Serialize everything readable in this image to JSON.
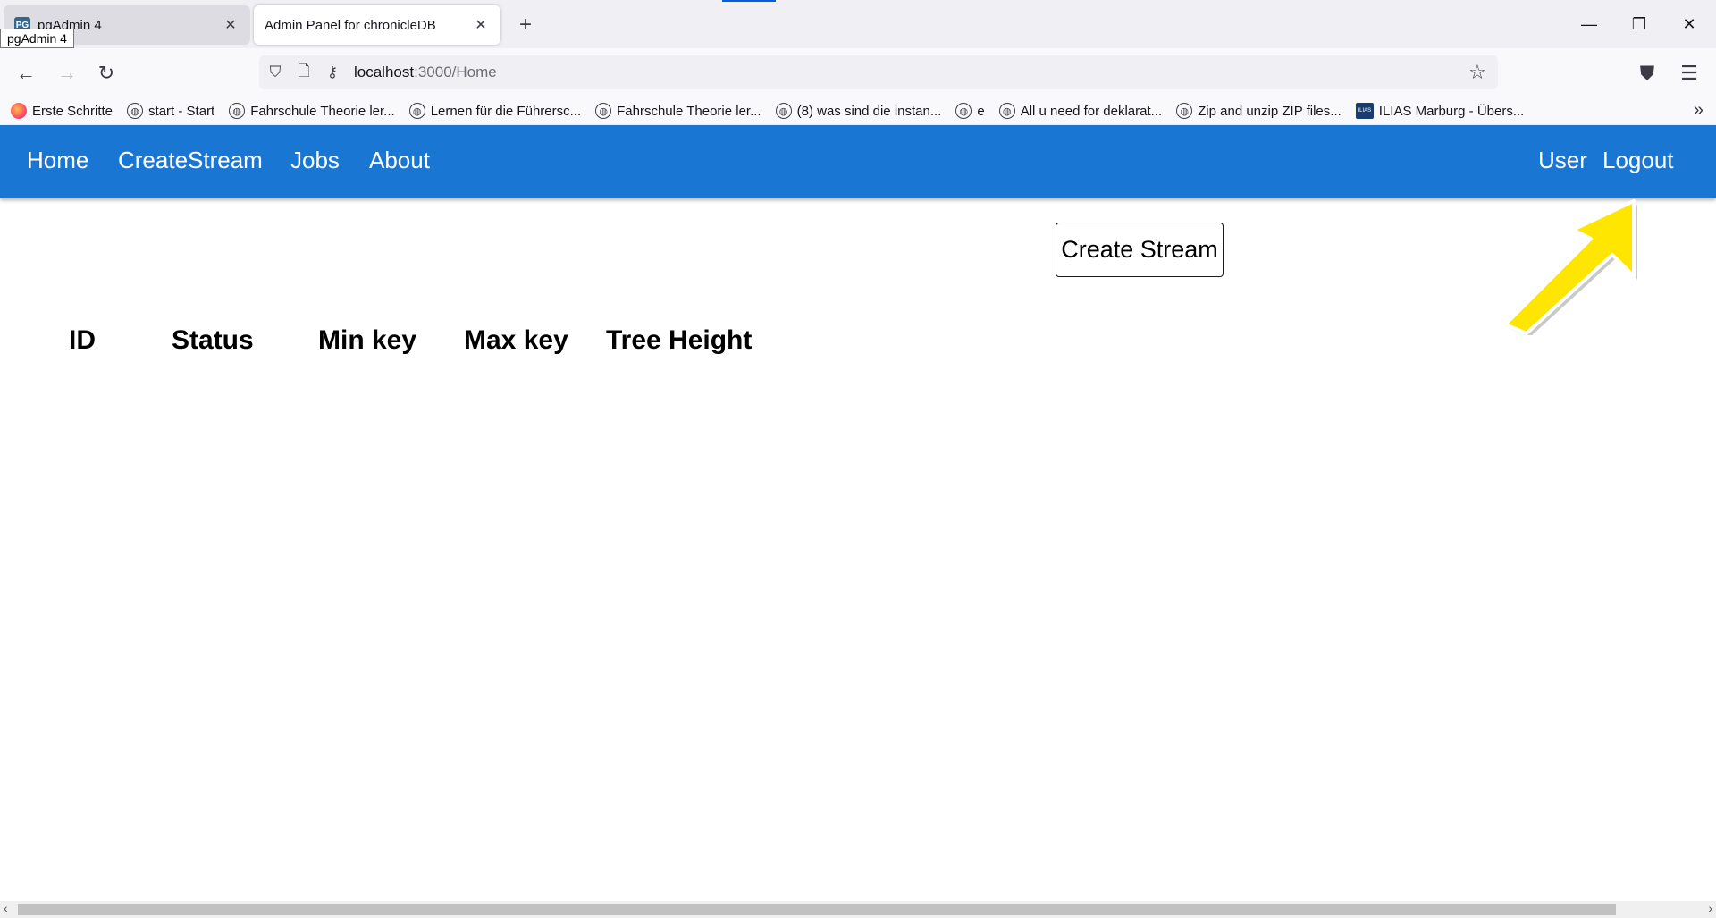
{
  "browser": {
    "tabs": [
      {
        "title": "pgAdmin 4",
        "favicon_text": "PG"
      },
      {
        "title": "Admin Panel for chronicleDB"
      }
    ],
    "tooltip": "pgAdmin 4",
    "url_host": "localhost",
    "url_path": ":3000/Home",
    "bookmarks": [
      {
        "label": "Erste Schritte",
        "icon": "firefox-icon"
      },
      {
        "label": "start - Start",
        "icon": "globe-icon"
      },
      {
        "label": "Fahrschule Theorie ler...",
        "icon": "globe-icon"
      },
      {
        "label": "Lernen für die Führersc...",
        "icon": "globe-icon"
      },
      {
        "label": "Fahrschule Theorie ler...",
        "icon": "globe-icon"
      },
      {
        "label": "(8) was sind die instan...",
        "icon": "globe-icon"
      },
      {
        "label": "e",
        "icon": "globe-icon"
      },
      {
        "label": "All u need for deklarat...",
        "icon": "globe-icon"
      },
      {
        "label": "Zip and unzip ZIP files...",
        "icon": "globe-icon"
      },
      {
        "label": "ILIAS Marburg - Übers...",
        "icon": "ilias-icon"
      }
    ]
  },
  "app": {
    "nav_left": [
      "Home",
      "CreateStream",
      "Jobs",
      "About"
    ],
    "nav_right": [
      "User",
      "Logout"
    ],
    "create_button": "Create Stream",
    "table_headers": [
      "ID",
      "Status",
      "Min key",
      "Max key",
      "Tree Height"
    ],
    "accent_color": "#1976d2",
    "annotation_color": "#ffe600"
  }
}
